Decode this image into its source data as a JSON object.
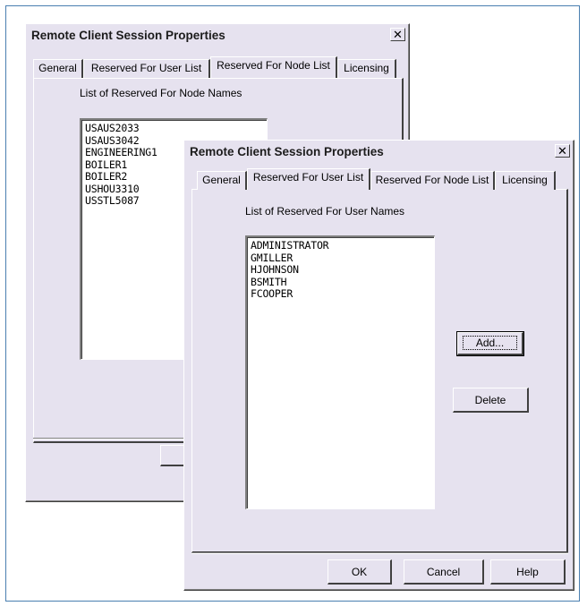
{
  "back_dialog": {
    "title": "Remote Client Session Properties",
    "close_glyph": "✕",
    "tabs": [
      "General",
      "Reserved For User List",
      "Reserved For Node List",
      "Licensing"
    ],
    "active_tab": "Reserved For Node List",
    "list_label": "List of Reserved For Node Names",
    "nodes": [
      "USAUS2033",
      "USAUS3042",
      "ENGINEERING1",
      "BOILER1",
      "BOILER2",
      "USHOU3310",
      "USSTL5087"
    ]
  },
  "front_dialog": {
    "title": "Remote Client Session Properties",
    "close_glyph": "✕",
    "tabs": [
      "General",
      "Reserved For User List",
      "Reserved For Node List",
      "Licensing"
    ],
    "active_tab": "Reserved For User List",
    "list_label": "List of Reserved For User Names",
    "users": [
      "ADMINISTRATOR",
      "GMILLER",
      "HJOHNSON",
      "BSMITH",
      "FCOOPER"
    ],
    "add_label": "Add...",
    "delete_label": "Delete",
    "ok_label": "OK",
    "cancel_label": "Cancel",
    "help_label": "Help"
  }
}
